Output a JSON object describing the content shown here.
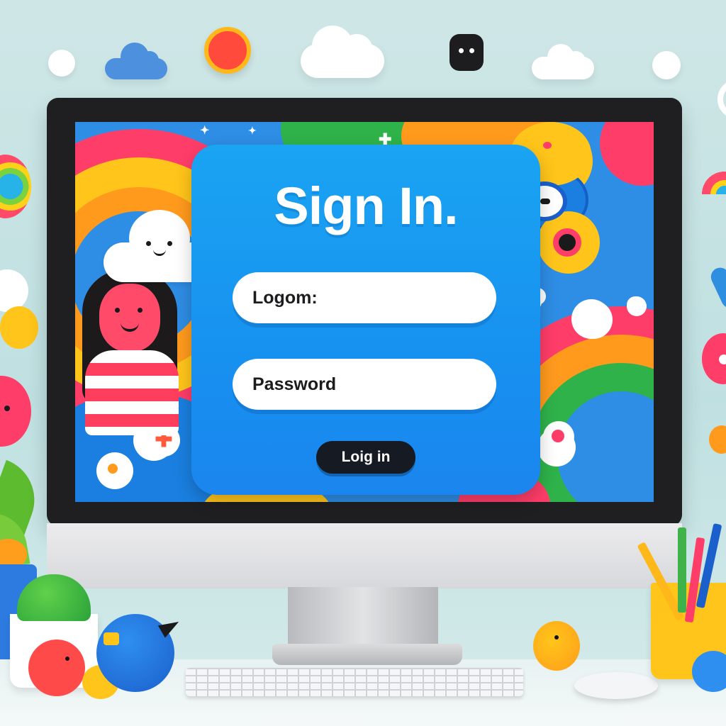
{
  "login": {
    "title": "Sign In.",
    "username_label": "Logom:",
    "password_label": "Password",
    "login_button": "Loig in"
  },
  "colors": {
    "card": "#1a9bf2",
    "button": "#161a22",
    "field": "#ffffff",
    "accent_pink": "#ff3d69",
    "accent_yellow": "#ffc51a",
    "accent_green": "#2fb24a"
  },
  "icons": [
    "plus-icon",
    "sparkle-icon",
    "smiley-icon",
    "cloud-icon",
    "bird-icon",
    "cactus-icon",
    "rainbow-icon"
  ]
}
